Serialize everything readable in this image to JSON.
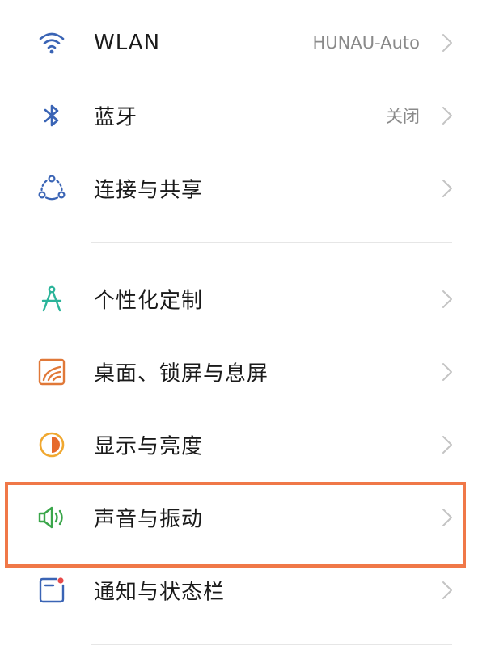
{
  "settings": {
    "group1": [
      {
        "label": "WLAN",
        "value": "HUNAU-Auto",
        "icon": "wifi-icon",
        "color": "#3a64b5"
      },
      {
        "label": "蓝牙",
        "value": "关闭",
        "icon": "bluetooth-icon",
        "color": "#3a64b5"
      },
      {
        "label": "连接与共享",
        "value": "",
        "icon": "share-connection-icon",
        "color": "#3a64b5"
      }
    ],
    "group2": [
      {
        "label": "个性化定制",
        "value": "",
        "icon": "compass-icon",
        "color": "#2bb49a"
      },
      {
        "label": "桌面、锁屏与息屏",
        "value": "",
        "icon": "wallpaper-icon",
        "color": "#e07838"
      },
      {
        "label": "显示与亮度",
        "value": "",
        "icon": "brightness-icon",
        "color": "#f0a830"
      },
      {
        "label": "声音与振动",
        "value": "",
        "icon": "speaker-icon",
        "color": "#3aa64a"
      },
      {
        "label": "通知与状态栏",
        "value": "",
        "icon": "notification-icon",
        "color": "#3a64b5"
      }
    ]
  },
  "highlight_color": "#f07848"
}
